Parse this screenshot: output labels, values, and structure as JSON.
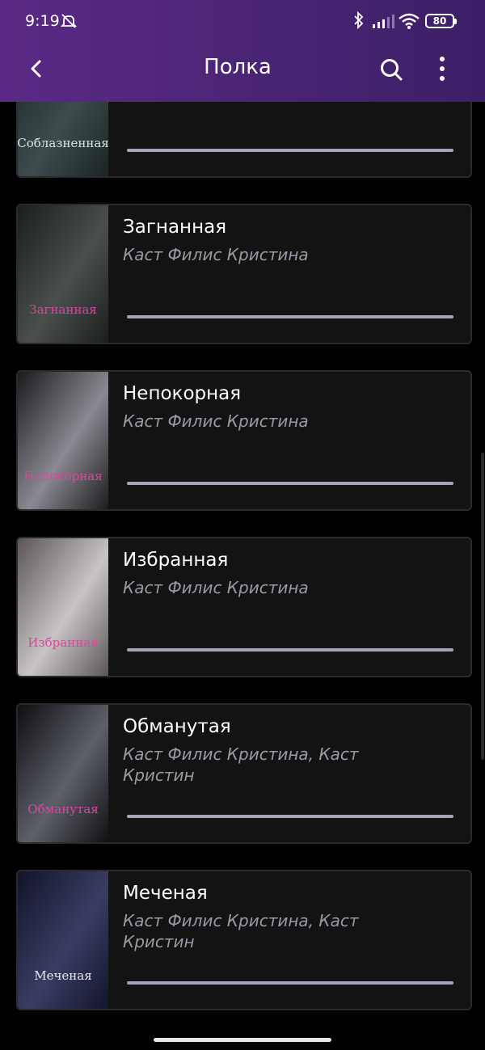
{
  "status_bar": {
    "time": "9:19",
    "battery": "80"
  },
  "app_bar": {
    "title": "Полка"
  },
  "books": [
    {
      "title": "",
      "author": "",
      "cover_text": "Соблазненная",
      "cover_colors": [
        "#1b2324",
        "#3d4c4d"
      ]
    },
    {
      "title": "Загнанная",
      "author": "Каст Филис Кристина",
      "cover_text": "Загнанная",
      "cover_colors": [
        "#1a1f1e",
        "#4a4f4c"
      ]
    },
    {
      "title": "Непокорная",
      "author": "Каст Филис Кристина",
      "cover_text": "Непокорная",
      "cover_colors": [
        "#1b1b1e",
        "#8a8890"
      ]
    },
    {
      "title": "Избранная",
      "author": "Каст Филис Кристина",
      "cover_text": "Избранная",
      "cover_colors": [
        "#5b5559",
        "#c8c3c5"
      ]
    },
    {
      "title": "Обманутая",
      "author": "Каст Филис Кристина, Каст Кристин",
      "cover_text": "Обманутая",
      "cover_colors": [
        "#0e0f12",
        "#5e6069"
      ]
    },
    {
      "title": "Меченая",
      "author": "Каст Филис Кристина, Каст Кристин",
      "cover_text": "Меченая",
      "cover_colors": [
        "#12142a",
        "#3a3d63"
      ]
    }
  ]
}
